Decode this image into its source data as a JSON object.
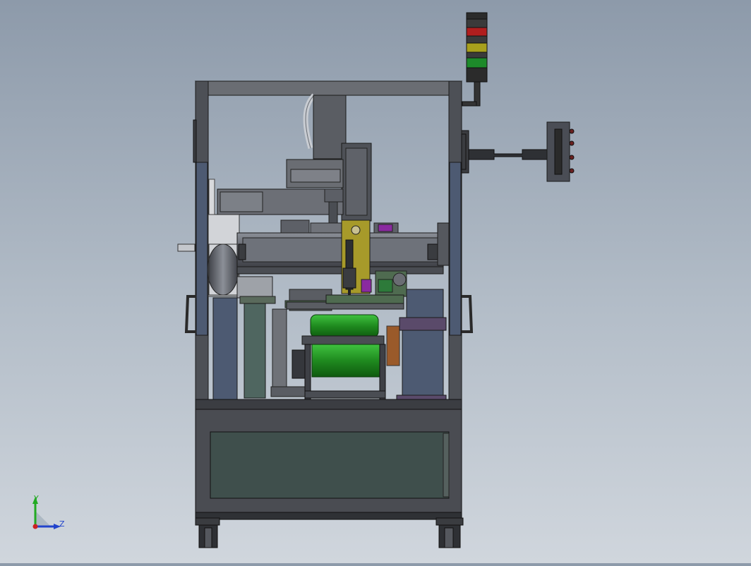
{
  "view": {
    "background_top": "#8d9aaa",
    "background_bottom": "#d0d6dd"
  },
  "triad": {
    "y_label": "Y",
    "z_label": "Z",
    "y_color": "#22aa22",
    "z_color": "#2244cc",
    "x_color": "#cc2222"
  },
  "machine": {
    "frame_color": "#4a4c52",
    "cabinet_color": "#3f4f4c",
    "panel_color": "#4d5a72",
    "head_color": "#a79a2a",
    "green_part_color": "#1f8a1f",
    "signal_tower": [
      "red",
      "yellow",
      "green"
    ]
  }
}
